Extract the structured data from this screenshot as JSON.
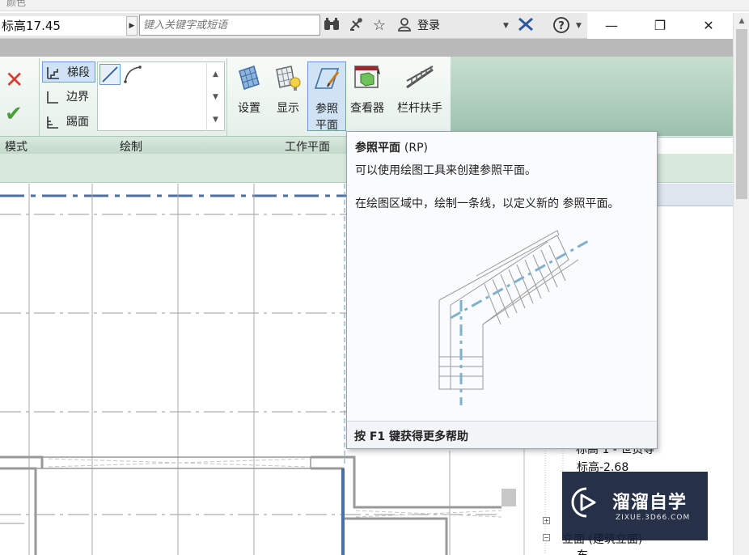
{
  "window": {
    "top_strip_label": "颜色",
    "level_name": "标高17.45",
    "search_placeholder": "键入关键字或短语",
    "login_label": "登录",
    "minimize_glyph": "—",
    "restore_glyph": "❐",
    "close_glyph": "✕"
  },
  "ribbon": {
    "panels": {
      "mode": "模式",
      "draw": "绘制",
      "work_plane": "工作平面"
    },
    "draw_items": [
      "梯段",
      "边界",
      "踢面"
    ],
    "tools": [
      {
        "label_line1": "设置",
        "label_line2": ""
      },
      {
        "label_line1": "显示",
        "label_line2": ""
      },
      {
        "label_line1": "参照",
        "label_line2": "平面"
      },
      {
        "label_line1": "查看器",
        "label_line2": ""
      },
      {
        "label_line1": "栏杆扶手",
        "label_line2": ""
      }
    ]
  },
  "tooltip": {
    "title": "参照平面",
    "shortcut": "(RP)",
    "line1": "可以使用绘图工具来创建参照平面。",
    "line2": "在绘图区域中，绘制一条线，以定义新的 参照平面。",
    "footer": "按 F1 键获得更多帮助"
  },
  "project_browser": {
    "items": [
      "标高 1 - 世贸等",
      "标高-2.68",
      "立面 (建筑立面)",
      "东"
    ]
  },
  "watermark": {
    "title": "溜溜自学",
    "subtitle": "ZIXUE.3D66.COM"
  },
  "colors": {
    "accent_blue": "#6b9cce",
    "ribbon_green": "#c7dfd1",
    "x_red": "#d93d2e",
    "check_green": "#4c9e3a",
    "ref_plane_blue": "#4a6fa5"
  }
}
